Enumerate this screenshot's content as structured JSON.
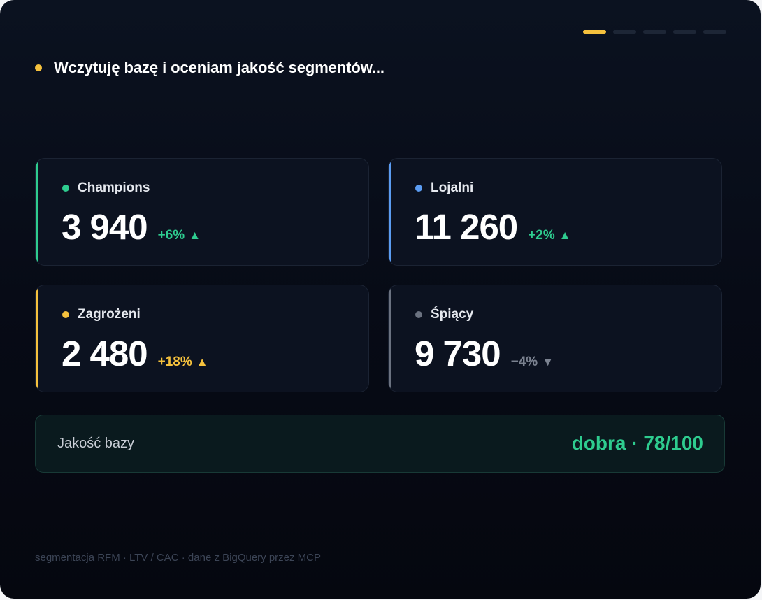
{
  "progress": {
    "steps": 5,
    "active_step": 1
  },
  "status": {
    "text": "Wczytuję bazę i oceniam jakość segmentów..."
  },
  "segments": [
    {
      "label": "Champions",
      "value": "3 940",
      "delta": "+6%",
      "direction": "up",
      "direction_icon": "triangle-up-icon",
      "accent_color": "#2ecc8f",
      "delta_color": "#2ecc8f"
    },
    {
      "label": "Lojalni",
      "value": "11 260",
      "delta": "+2%",
      "direction": "up",
      "direction_icon": "triangle-up-icon",
      "accent_color": "#5b9cf2",
      "delta_color": "#2ecc8f"
    },
    {
      "label": "Zagrożeni",
      "value": "2 480",
      "delta": "+18%",
      "direction": "up",
      "direction_icon": "triangle-up-icon",
      "accent_color": "#f5c13d",
      "delta_color": "#f5c13d"
    },
    {
      "label": "Śpiący",
      "value": "9 730",
      "delta": "−4%",
      "direction": "down",
      "direction_icon": "triangle-down-icon",
      "accent_color": "#6b7280",
      "delta_color": "#7b8290"
    }
  ],
  "quality": {
    "label": "Jakość bazy",
    "value": "dobra · 78/100",
    "color": "#2ecc8f"
  },
  "footer": {
    "text": "segmentacja RFM · LTV / CAC · dane z BigQuery przez MCP"
  }
}
